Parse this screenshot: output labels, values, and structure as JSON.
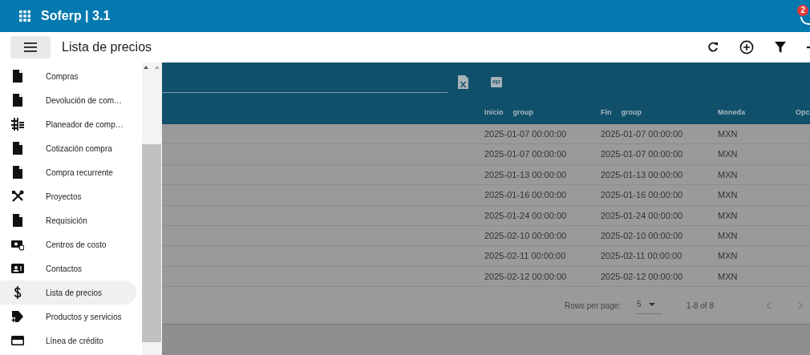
{
  "app": {
    "title": "Soferp | 3.1",
    "notification_count": "2"
  },
  "toolbar": {
    "title": "Lista de precios"
  },
  "sidebar": {
    "items": [
      {
        "label": "Compras",
        "selected": false
      },
      {
        "label": "Devolución de com…",
        "selected": false
      },
      {
        "label": "Planeador de comp…",
        "selected": false
      },
      {
        "label": "Cotización compra",
        "selected": false
      },
      {
        "label": "Compra recurrente",
        "selected": false
      },
      {
        "label": "Proyectos",
        "selected": false
      },
      {
        "label": "Requisición",
        "selected": false
      },
      {
        "label": "Centros de costo",
        "selected": false
      },
      {
        "label": "Contactos",
        "selected": false
      },
      {
        "label": "Lista de precios",
        "selected": true
      },
      {
        "label": "Productos y servicios",
        "selected": false
      },
      {
        "label": "Línea de crédito",
        "selected": false
      }
    ]
  },
  "table": {
    "columns": [
      {
        "label": "Inicio",
        "tag": "group"
      },
      {
        "label": "Fin",
        "tag": "group"
      },
      {
        "label": "Moneda"
      },
      {
        "label": "Opc"
      }
    ],
    "rows": [
      [
        "2025-01-07 00:00:00",
        "2025-01-07 00:00:00",
        "MXN"
      ],
      [
        "2025-01-07 00:00:00",
        "2025-01-07 00:00:00",
        "MXN"
      ],
      [
        "2025-01-13 00:00:00",
        "2025-01-13 00:00:00",
        "MXN"
      ],
      [
        "2025-01-16 00:00:00",
        "2025-01-16 00:00:00",
        "MXN"
      ],
      [
        "2025-01-24 00:00:00",
        "2025-01-24 00:00:00",
        "MXN"
      ],
      [
        "2025-02-10 00:00:00",
        "2025-02-10 00:00:00",
        "MXN"
      ],
      [
        "2025-02-11 00:00:00",
        "2025-02-11 00:00:00",
        "MXN"
      ],
      [
        "2025-02-12 00:00:00",
        "2025-02-12 00:00:00",
        "MXN"
      ]
    ]
  },
  "pagination": {
    "rows_per_page_label": "Rows per page:",
    "rows_per_page": "5",
    "range": "1-8 of 8"
  }
}
